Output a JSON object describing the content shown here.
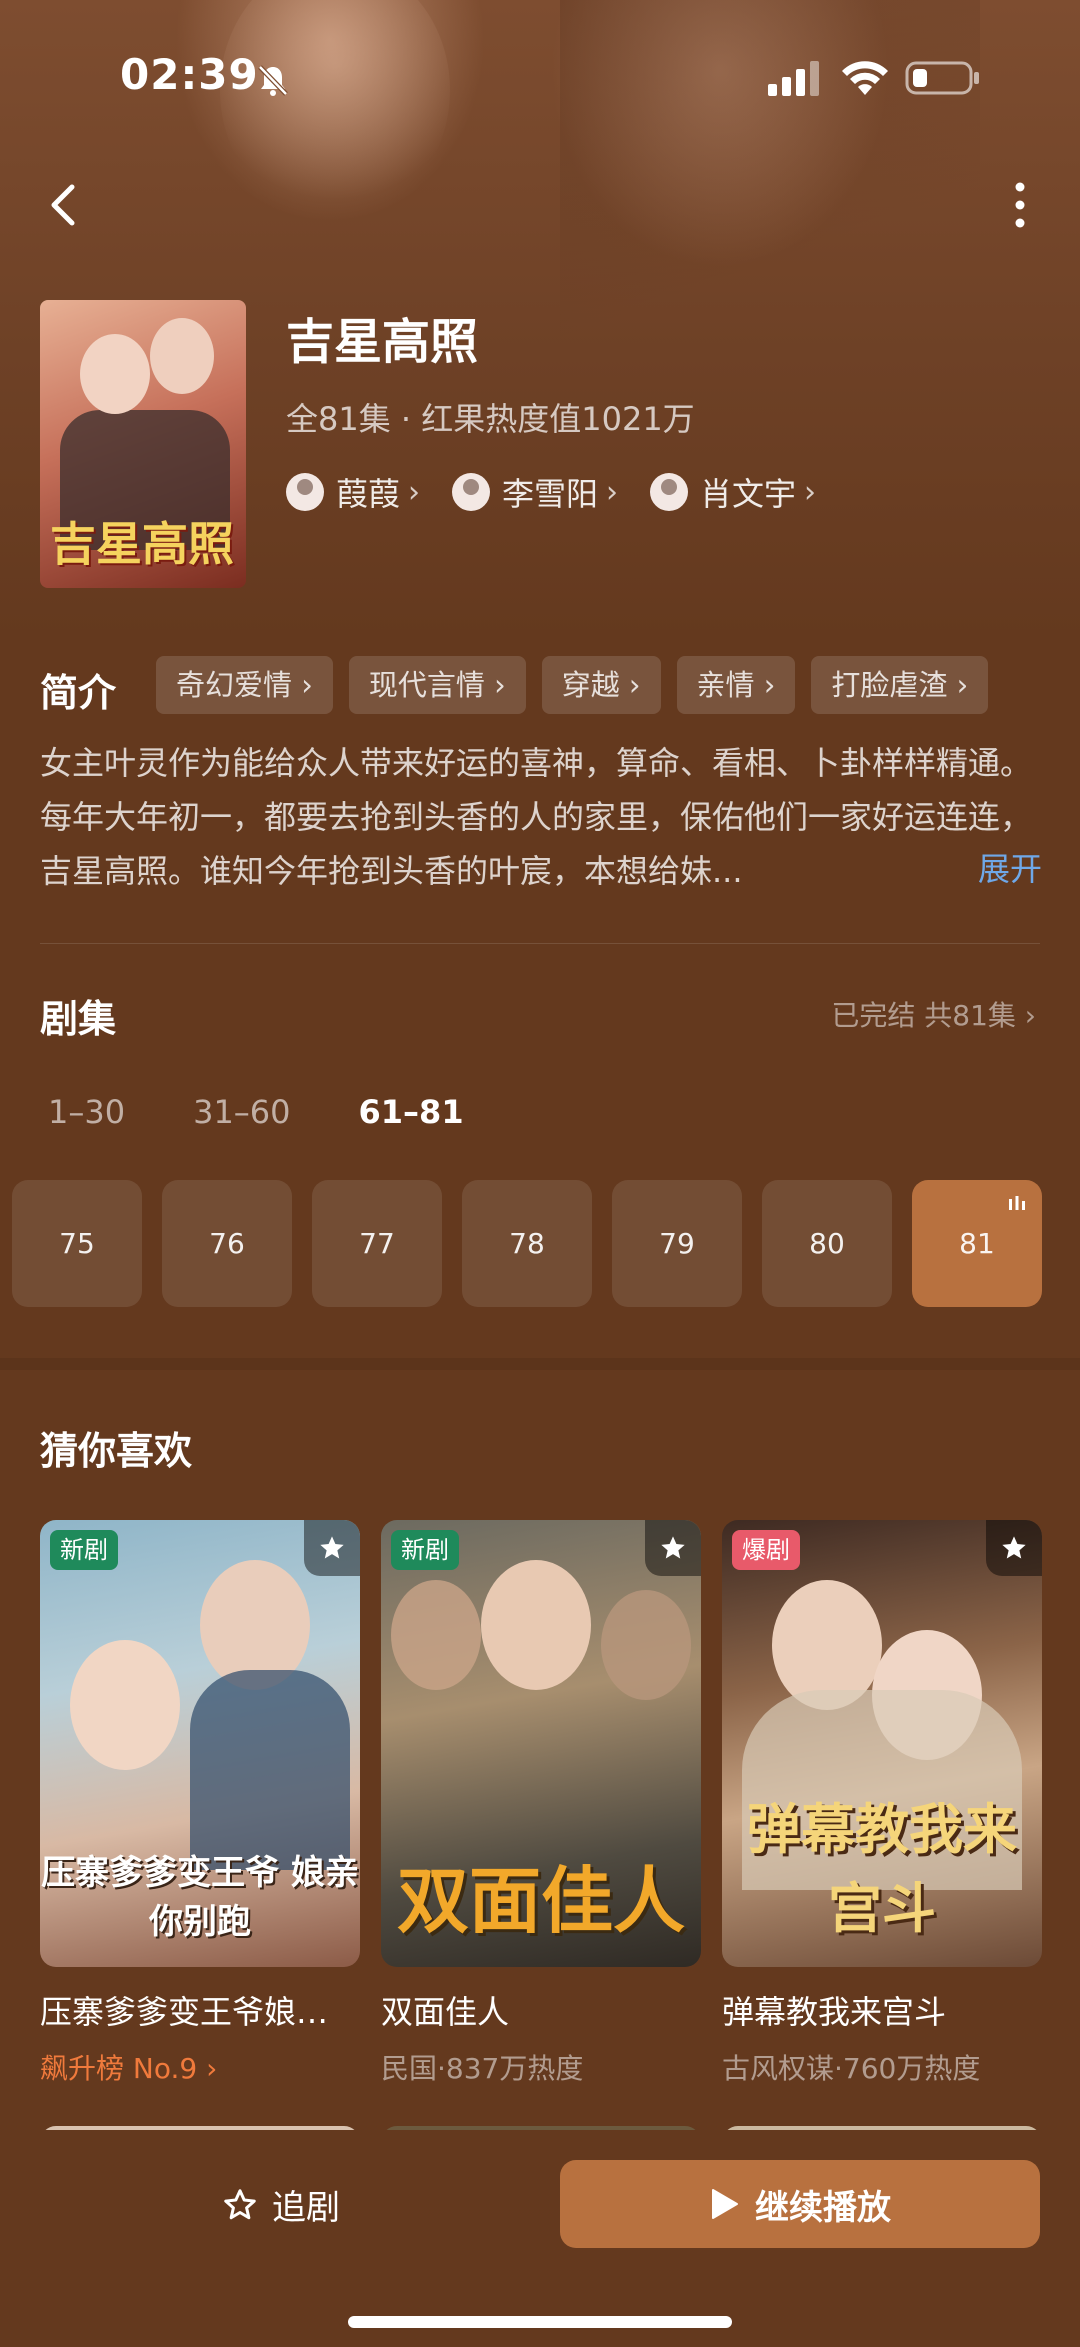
{
  "status_bar": {
    "time": "02:39"
  },
  "drama": {
    "title": "吉星高照",
    "poster_text": "吉星高照",
    "meta": "全81集 · 红果热度值1021万",
    "actors": [
      "葭葭",
      "李雪阳",
      "肖文宇"
    ]
  },
  "intro": {
    "label": "简介",
    "tags": [
      "奇幻爱情",
      "现代言情",
      "穿越",
      "亲情",
      "打脸虐渣"
    ],
    "description": "女主叶灵作为能给众人带来好运的喜神，算命、看相、卜卦样样精通。每年大年初一，都要去抢到头香的人的家里，保佑他们一家好运连连，吉星高照。谁知今年抢到头香的叶宸，本想给妹...",
    "expand_label": "展开"
  },
  "episodes": {
    "title": "剧集",
    "status": "已完结 共81集",
    "ranges": [
      "1–30",
      "31–60",
      "61–81"
    ],
    "active_range": "61–81",
    "items": [
      "75",
      "76",
      "77",
      "78",
      "79",
      "80",
      "81"
    ],
    "current": "81"
  },
  "recommend": {
    "title": "猜你喜欢",
    "cards": [
      {
        "badge": "新剧",
        "cover_text": "压寨爹爹变王爷 娘亲你别跑",
        "name": "压寨爹爹变王爷娘亲你别跑",
        "sub": "飙升榜 No.9"
      },
      {
        "badge": "新剧",
        "cover_text": "双面佳人",
        "name": "双面佳人",
        "sub": "民国·837万热度"
      },
      {
        "badge": "爆剧",
        "cover_text": "弹幕教我来宫斗",
        "name": "弹幕教我来宫斗",
        "sub": "古风权谋·760万热度"
      }
    ]
  },
  "bottom_bar": {
    "follow_label": "追剧",
    "play_label": "继续播放"
  },
  "colors": {
    "background": "#64391e",
    "accent": "#b8713f",
    "link": "#6fa8e8",
    "rank": "#f07a3c",
    "badge_new": "#1f8a5b",
    "badge_hot": "#e85a6a"
  }
}
